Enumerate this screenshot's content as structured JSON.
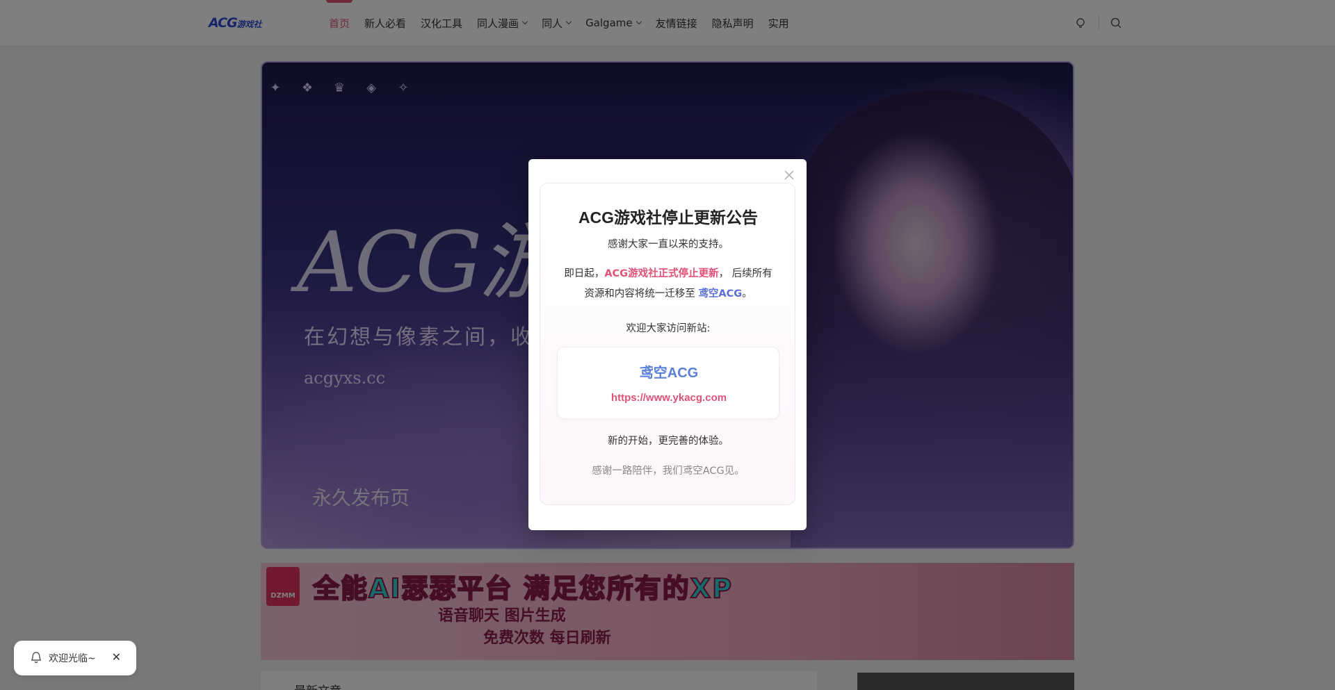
{
  "header": {
    "logo": "ACG",
    "logo_sub": "游戏社",
    "nav": [
      {
        "label": "首页",
        "dropdown": false,
        "active": true
      },
      {
        "label": "新人必看",
        "dropdown": false
      },
      {
        "label": "汉化工具",
        "dropdown": false
      },
      {
        "label": "同人漫画",
        "dropdown": true
      },
      {
        "label": "同人",
        "dropdown": true
      },
      {
        "label": "Galgame",
        "dropdown": true
      },
      {
        "label": "友情链接",
        "dropdown": false
      },
      {
        "label": "隐私声明",
        "dropdown": false
      },
      {
        "label": "实用",
        "dropdown": false
      }
    ],
    "icons": [
      "theme-toggle-icon",
      "search-icon"
    ]
  },
  "banner": {
    "title": "ACG游",
    "slogan": "在幻想与像素之间，收",
    "url": "acgyxs.cc",
    "tag": "永久发布页"
  },
  "ad": {
    "logo": "DZMM",
    "title": "全能AI瑟瑟平台 满足您所有的XP",
    "line1": "语音聊天  图片生成",
    "line2": "免费次数  每日刷新"
  },
  "section": {
    "latest": "最新文章"
  },
  "toast": {
    "text": "欢迎光临~",
    "close": "✕"
  },
  "modal": {
    "title": "ACG游戏社停止更新公告",
    "thanks": "感谢大家一直以来的支持。",
    "notice_prefix": "即日起，",
    "notice_highlight": "ACG游戏社正式停止更新",
    "notice_suffix": "，  后续所有",
    "notice_line2_prefix": "资源和内容将统一迁移至 ",
    "notice_line2_link": "鸢空ACG",
    "notice_line2_suffix": "。",
    "visit": "欢迎大家访问新站:",
    "card_name": "鸢空ACG",
    "card_url": "https://www.ykacg.com",
    "new_start": "新的开始，更完善的体验。",
    "farewell": "感谢一路陪伴，我们鸢空ACG见。"
  },
  "colors": {
    "accent_pink": "#e05276",
    "accent_blue": "#5a6fd6"
  }
}
